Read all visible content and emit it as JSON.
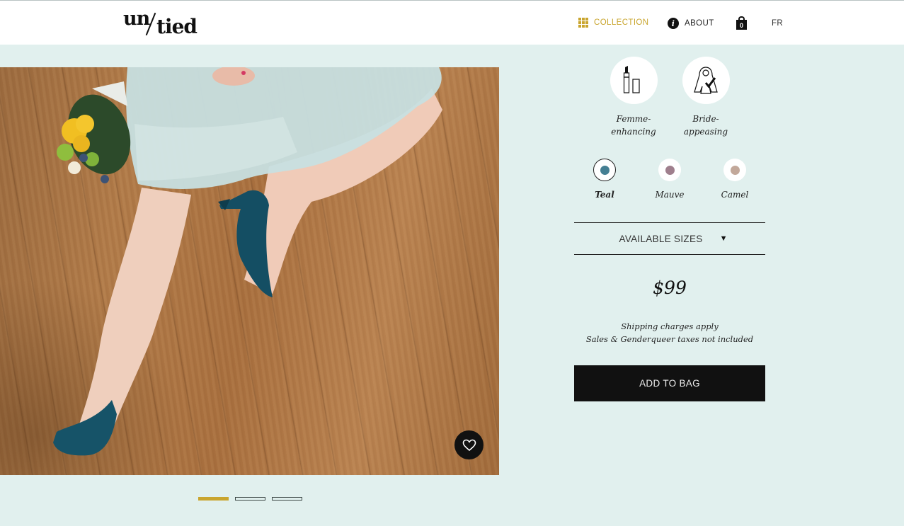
{
  "header": {
    "logo": {
      "part1": "un",
      "part2": "tied"
    },
    "nav": [
      {
        "label": "COLLECTION",
        "icon": "grid-icon",
        "active": true
      },
      {
        "label": "ABOUT",
        "icon": "info-icon",
        "active": false
      }
    ],
    "bag": {
      "icon": "shopping-bag-icon",
      "count": "0"
    },
    "language": "FR"
  },
  "gallery": {
    "image_alt": "Woman in pale blue chiffon dress sitting on wooden floor with teal suede pumps and a yellow flower bouquet",
    "favorite_icon": "heart-icon",
    "slides": 3,
    "active_slide": 1
  },
  "product": {
    "features": [
      {
        "icon": "lipstick-icon",
        "label_line1": "Femme-",
        "label_line2": "enhancing"
      },
      {
        "icon": "bride-veil-icon",
        "label_line1": "Bride-",
        "label_line2": "appeasing"
      }
    ],
    "colors": [
      {
        "name": "Teal",
        "hex": "#447f93",
        "selected": true
      },
      {
        "name": "Mauve",
        "hex": "#9f7f8d",
        "selected": false
      },
      {
        "name": "Camel",
        "hex": "#c2a89a",
        "selected": false
      }
    ],
    "sizes_label": "AVAILABLE SIZES",
    "sizes_caret": "▼",
    "price": "$99",
    "shipping_note": "Shipping charges apply",
    "tax_note": "Sales & Genderqueer taxes not included",
    "add_to_bag": "ADD TO BAG"
  },
  "colors": {
    "accent": "#c9a52e",
    "background": "#e1f0ee",
    "button": "#111111"
  }
}
